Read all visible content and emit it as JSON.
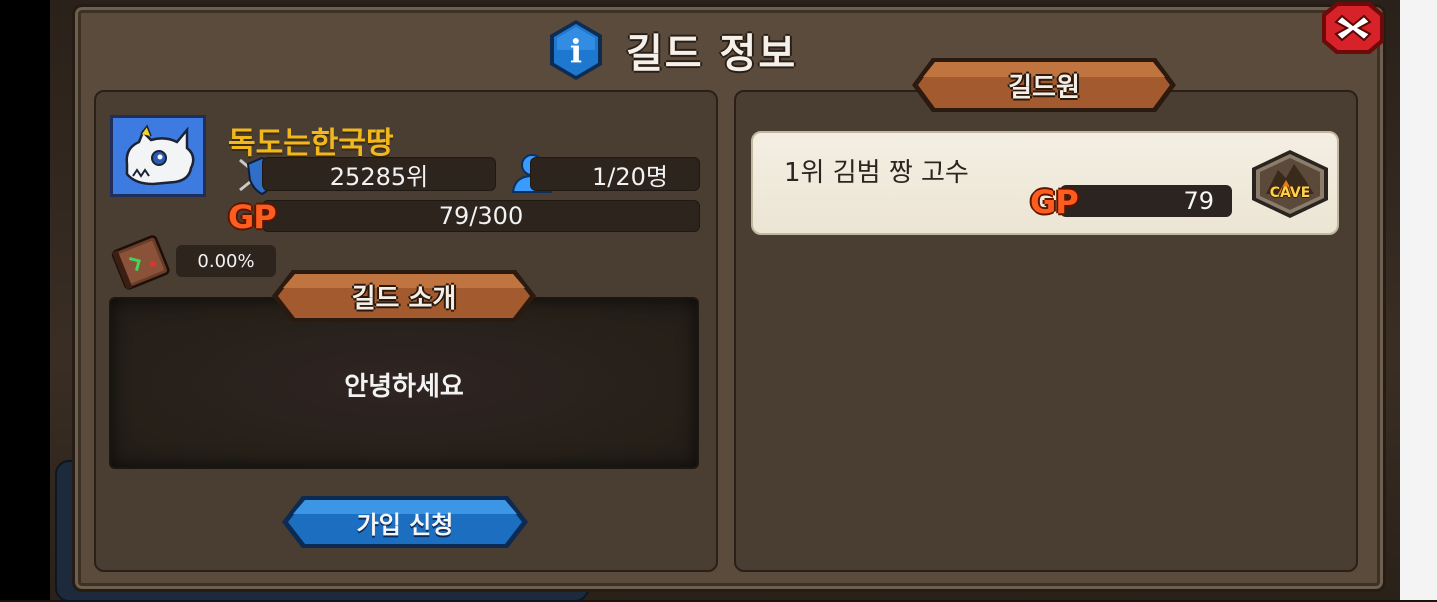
{
  "dialog": {
    "title": "길드 정보",
    "info_icon_glyph": "i"
  },
  "guild": {
    "name": "독도는한국땅",
    "rank": "25285위",
    "members": "1/20명",
    "gp_label": "GP",
    "gp": "79/300",
    "exp_percent": "0.00%"
  },
  "intro": {
    "header": "길드 소개",
    "text": "안녕하세요"
  },
  "join_button": {
    "label": "가입 신청"
  },
  "members_panel": {
    "header": "길드원",
    "members": [
      {
        "name": "1위 김범 짱 고수",
        "gp_label": "GP",
        "gp": "79",
        "badge": "CAVE"
      }
    ]
  },
  "colors": {
    "guild_name": "#f1b81e",
    "gp": "#ff5c1f",
    "panel": "#4a3d31",
    "join_button": "#1c6fc0"
  },
  "icons": [
    "info-icon",
    "close-icon",
    "dragon-skull-emblem",
    "shield-rank-icon",
    "user-icon",
    "book-icon",
    "cave-badge-icon"
  ]
}
